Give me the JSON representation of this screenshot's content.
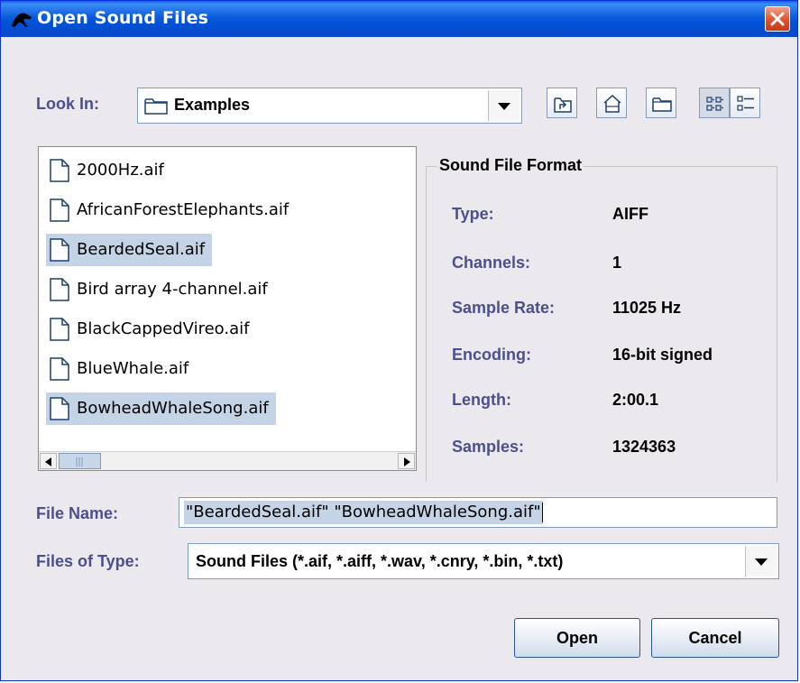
{
  "window": {
    "title": "Open Sound Files",
    "close_icon": "close-icon"
  },
  "toolbar": {
    "look_in_label": "Look In:",
    "look_in_value": "Examples",
    "buttons": [
      "up-one-level-icon",
      "home-icon",
      "new-folder-icon",
      "list-view-icon",
      "details-view-icon"
    ]
  },
  "files": [
    {
      "name": "2000Hz.aif",
      "selected": false
    },
    {
      "name": "AfricanForestElephants.aif",
      "selected": false
    },
    {
      "name": "BeardedSeal.aif",
      "selected": true
    },
    {
      "name": "Bird array 4-channel.aif",
      "selected": false
    },
    {
      "name": "BlackCappedVireo.aif",
      "selected": false
    },
    {
      "name": "BlueWhale.aif",
      "selected": false
    },
    {
      "name": "BowheadWhaleSong.aif",
      "selected": true
    }
  ],
  "format": {
    "title": "Sound File Format",
    "rows": [
      {
        "key": "Type:",
        "value": "AIFF"
      },
      {
        "key": "Channels:",
        "value": "1"
      },
      {
        "key": "Sample Rate:",
        "value": "11025 Hz"
      },
      {
        "key": "Encoding:",
        "value": "16-bit signed"
      },
      {
        "key": "Length:",
        "value": "2:00.1"
      },
      {
        "key": "Samples:",
        "value": "1324363"
      }
    ]
  },
  "file_name": {
    "label": "File Name:",
    "value": "\"BeardedSeal.aif\" \"BowheadWhaleSong.aif\""
  },
  "file_type": {
    "label": "Files of Type:",
    "value": "Sound Files (*.aif, *.aiff, *.wav, *.cnry, *.bin, *.txt)"
  },
  "actions": {
    "open_label": "Open",
    "cancel_label": "Cancel"
  }
}
